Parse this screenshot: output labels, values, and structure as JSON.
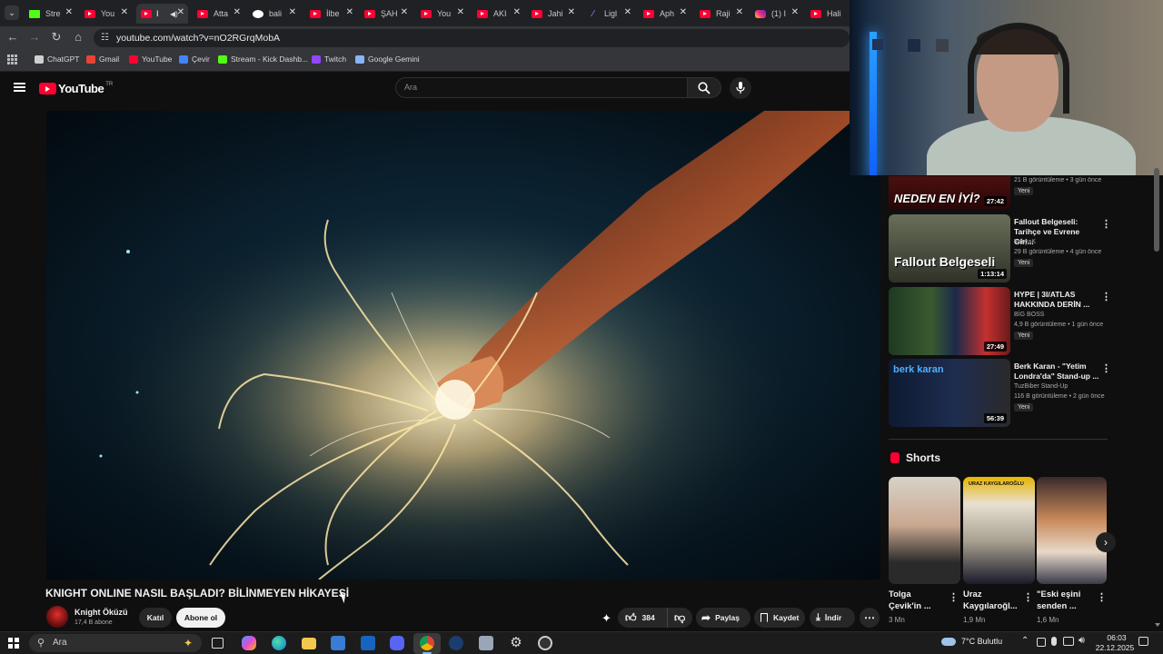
{
  "browser": {
    "tabs": [
      {
        "label": "Stre",
        "icon": "kick-icon"
      },
      {
        "label": "You",
        "icon": "youtube-icon"
      },
      {
        "label": "I",
        "icon": "youtube-icon"
      },
      {
        "label": "Atta",
        "icon": "youtube-icon"
      },
      {
        "label": "bali",
        "icon": "google-icon"
      },
      {
        "label": "İlbe",
        "icon": "youtube-icon"
      },
      {
        "label": "ŞAH",
        "icon": "youtube-icon"
      },
      {
        "label": "You",
        "icon": "youtube-icon"
      },
      {
        "label": "AKI",
        "icon": "youtube-icon"
      },
      {
        "label": "Jahi",
        "icon": "youtube-icon"
      },
      {
        "label": "Ligl",
        "icon": "gemini-icon"
      },
      {
        "label": "Aph",
        "icon": "youtube-icon"
      },
      {
        "label": "Raji",
        "icon": "youtube-icon"
      },
      {
        "label": "(1) I",
        "icon": "instagram-icon"
      },
      {
        "label": "Hali",
        "icon": "youtube-icon"
      }
    ],
    "url": "youtube.com/watch?v=nO2RGrqMobA",
    "bookmarks": [
      {
        "label": "ChatGPT",
        "color": "#d0d0d0"
      },
      {
        "label": "Gmail",
        "color": "#ea4335"
      },
      {
        "label": "YouTube",
        "color": "#ff0033"
      },
      {
        "label": "Çevir",
        "color": "#4285f4"
      },
      {
        "label": "Stream - Kick Dashb...",
        "color": "#53fc18"
      },
      {
        "label": "Twitch",
        "color": "#9146ff"
      },
      {
        "label": "Google Gemini",
        "color": "#8ab4f8"
      }
    ]
  },
  "youtube": {
    "logo_text": "YouTube",
    "region": "TR",
    "search_placeholder": "Ara",
    "video": {
      "title": "KNIGHT ONLINE NASIL BAŞLADI? BİLİNMEYEN HİKAYESİ",
      "channel": "Knight Öküzü",
      "subscribers": "17,4 B abone",
      "join_label": "Katıl",
      "subscribe_label": "Abone ol",
      "likes": "384",
      "share_label": "Paylaş",
      "save_label": "Kaydet",
      "download_label": "İndir"
    },
    "sidebar": [
      {
        "title": "",
        "channel": "",
        "meta": "21 B görüntüleme • 3 gün önce",
        "badge": "Yeni",
        "duration": "27:42",
        "thumb_text": "NEDEN EN İYİ?"
      },
      {
        "title": "Fallout Belgeseli: Tarihçe ve Evrene Giri...",
        "channel": "YahyaK",
        "meta": "29 B görüntüleme • 4 gün önce",
        "badge": "Yeni",
        "duration": "1:13:14",
        "thumb_text": "Fallout Belgeseli"
      },
      {
        "title": "HYPE | 3I/ATLAS HAKKINDA DERİN ...",
        "channel": "BİG BOSS",
        "meta": "4,9 B görüntüleme • 1 gün önce",
        "badge": "Yeni",
        "duration": "27:49",
        "thumb_text": ""
      },
      {
        "title": "Berk Karan - \"Yetim Londra'da\" Stand-up ...",
        "channel": "TuzBiber Stand-Up",
        "meta": "116 B görüntüleme • 2 gün önce",
        "badge": "Yeni",
        "duration": "56:39",
        "thumb_text": "berk karan"
      }
    ],
    "shorts_heading": "Shorts",
    "shorts": [
      {
        "title": "Tolga Çevik'in ...",
        "views": "3 Mn",
        "thumb_text": ""
      },
      {
        "title": "Uraz Kaygılaroğl...",
        "views": "1,9 Mn",
        "thumb_text": "URAZ KAYGILAROĞLU"
      },
      {
        "title": "\"Eski eşini senden ...",
        "views": "1,6 Mn",
        "thumb_text": ""
      }
    ]
  },
  "taskbar": {
    "search_placeholder": "Ara",
    "weather": "7°C Bulutlu",
    "time": "06:03",
    "date": "22.12.2025"
  }
}
